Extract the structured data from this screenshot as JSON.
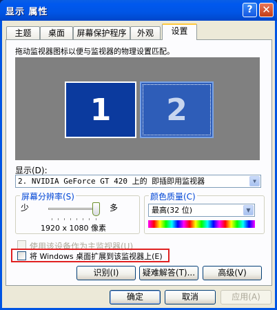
{
  "window": {
    "title": "显示 属性",
    "help_glyph": "?",
    "close_glyph": "✕"
  },
  "tabs": [
    {
      "label": "主题",
      "active": false
    },
    {
      "label": "桌面",
      "active": false
    },
    {
      "label": "屏幕保护程序",
      "active": false
    },
    {
      "label": "外观",
      "active": false
    },
    {
      "label": "设置",
      "active": true
    }
  ],
  "settings": {
    "instruction": "拖动监视器图标以便与监视器的物理设置匹配。",
    "monitors": [
      "1",
      "2"
    ],
    "selected_monitor": "2",
    "display_label": "显示(D):",
    "display_value": "2. NVIDIA GeForce GT 420 上的 即插即用监视器",
    "resolution": {
      "title": "屏幕分辨率(S)",
      "less": "少",
      "more": "多",
      "value": "1920 x 1080 像素",
      "slider_level": 1.0
    },
    "color_quality": {
      "title": "颜色质量(C)",
      "value": "最高(32 位)"
    },
    "primary_checkbox": {
      "label": "使用该设备作为主监视器(U)",
      "checked": false,
      "enabled": false
    },
    "extend_checkbox": {
      "label": "将 Windows 桌面扩展到该监视器上(E)",
      "checked": false,
      "enabled": true
    },
    "buttons": {
      "identify": "识别(I)",
      "troubleshoot": "疑难解答(T)...",
      "advanced": "高级(V)"
    }
  },
  "footer": {
    "ok": "确定",
    "cancel": "取消",
    "apply": "应用(A)"
  },
  "colors": {
    "titlebar": "#0058ee",
    "client_bg": "#ece9d8",
    "highlight_box": "#e02020",
    "group_title": "#0046d5"
  }
}
